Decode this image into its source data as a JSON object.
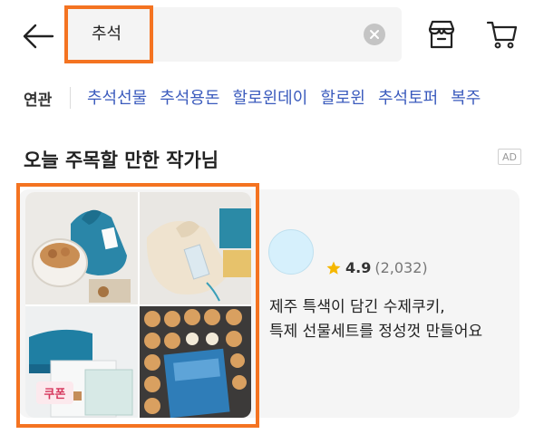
{
  "header": {
    "search_value": "추석",
    "back_icon": "arrow-left-icon",
    "clear_icon": "clear-icon",
    "shop_icon": "store-icon",
    "cart_icon": "cart-icon"
  },
  "related": {
    "label": "연관",
    "keywords": [
      "추석선물",
      "추석용돈",
      "할로윈데이",
      "할로윈",
      "추석토퍼",
      "복주"
    ]
  },
  "section": {
    "title": "오늘 주목할 만한 작가님",
    "ad_label": "AD"
  },
  "card": {
    "coupon_label": "쿠폰",
    "rating": "4.9",
    "review_count": "(2,032)",
    "description_line1": "제주 특색이 담긴 수제쿠키,",
    "description_line2": "특제 선물세트를 정성껏 만들어요"
  },
  "colors": {
    "accent_highlight": "#f47321",
    "keyword_blue": "#3b5bbd",
    "coupon_red": "#d6385d",
    "star_yellow": "#f5b700"
  }
}
